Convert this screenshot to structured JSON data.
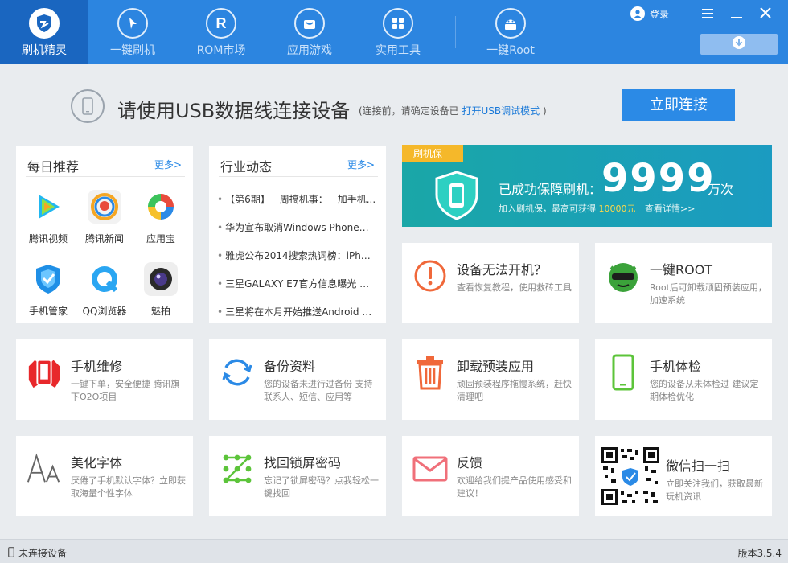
{
  "nav": {
    "items": [
      {
        "label": "刷机精灵",
        "icon": "shield-logo-icon"
      },
      {
        "label": "一键刷机",
        "icon": "cursor-icon"
      },
      {
        "label": "ROM市场",
        "icon": "rom-r-icon"
      },
      {
        "label": "应用游戏",
        "icon": "bag-icon"
      },
      {
        "label": "实用工具",
        "icon": "grid-icon"
      },
      {
        "label": "一键Root",
        "icon": "android-icon"
      }
    ],
    "login_label": "登录",
    "colors": {
      "bar": "#2c85e0",
      "active": "#1a66c0"
    }
  },
  "connect": {
    "title": "请使用USB数据线连接设备",
    "hint_prefix": "(连接前，请确定设备已",
    "hint_link": "打开USB调试模式",
    "hint_suffix": ")",
    "button": "立即连接"
  },
  "daily": {
    "title": "每日推荐",
    "more": "更多>",
    "apps": [
      {
        "label": "腾讯视频",
        "icon": "tencent-video-icon"
      },
      {
        "label": "腾讯新闻",
        "icon": "tencent-news-icon"
      },
      {
        "label": "应用宝",
        "icon": "app-store-icon"
      },
      {
        "label": "手机管家",
        "icon": "phone-manager-icon"
      },
      {
        "label": "QQ浏览器",
        "icon": "qq-browser-icon"
      },
      {
        "label": "魅拍",
        "icon": "camera-icon"
      }
    ]
  },
  "news": {
    "title": "行业动态",
    "more": "更多>",
    "items": [
      "【第6期】一周搞机事：一加手机...",
      "华为宣布取消Windows Phone手...",
      "雅虎公布2014搜索热词榜：iPhon...",
      "三星GALAXY E7官方信息曝光 配5...",
      "三星将在本月开始推送Android 5...."
    ]
  },
  "promo": {
    "tag": "刷机保",
    "text": "已成功保障刷机：",
    "count": "9999",
    "unit": "万次",
    "sub_prefix": "加入刷机保，最高可获得",
    "sub_amount": "10000元",
    "sub_link": "查看详情>>"
  },
  "cards": [
    {
      "title": "设备无法开机？",
      "desc": "查看恢复教程，使用救砖工具",
      "icon": "alert-icon"
    },
    {
      "title": "一键ROOT",
      "desc": "Root后可卸载顽固预装应用，加速系统",
      "icon": "root-mascot-icon"
    },
    {
      "title": "手机维修",
      "desc": "一键下单，安全便捷 腾讯旗下O2O项目",
      "icon": "repair-icon"
    },
    {
      "title": "备份资料",
      "desc": "您的设备未进行过备份 支持联系人、短信、应用等",
      "icon": "sync-icon"
    },
    {
      "title": "卸载预装应用",
      "desc": "顽固预装程序拖慢系统，赶快清理吧",
      "icon": "trash-icon"
    },
    {
      "title": "手机体检",
      "desc": "您的设备从未体检过 建议定期体检优化",
      "icon": "phone-check-icon"
    },
    {
      "title": "美化字体",
      "desc": "厌倦了手机默认字体？立即获取海量个性字体",
      "icon": "font-icon"
    },
    {
      "title": "找回锁屏密码",
      "desc": "忘记了锁屏密码？点我轻松一键找回",
      "icon": "pattern-lock-icon"
    },
    {
      "title": "反馈",
      "desc": "欢迎给我们提产品使用感受和建议！",
      "icon": "mail-icon"
    },
    {
      "title": "微信扫一扫",
      "desc": "立即关注我们，获取最新玩机资讯",
      "icon": "qr-code-icon"
    }
  ],
  "status": {
    "left": "未连接设备",
    "right": "版本3.5.4"
  }
}
